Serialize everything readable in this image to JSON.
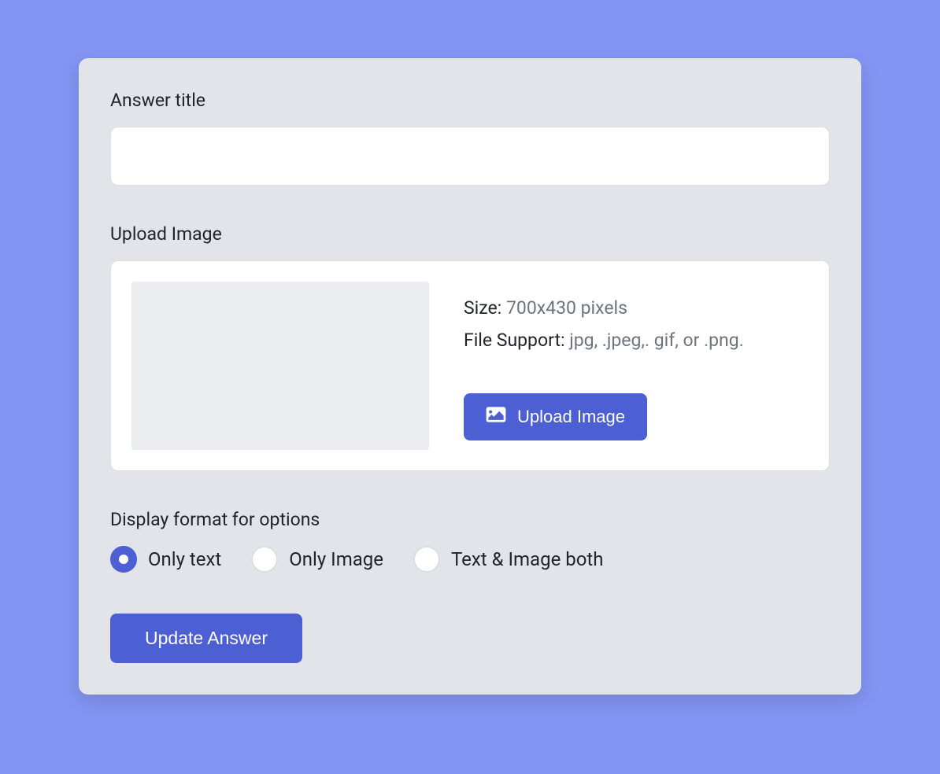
{
  "answer_title": {
    "label": "Answer title",
    "value": ""
  },
  "upload_image": {
    "label": "Upload Image",
    "size_label": "Size:",
    "size_value": "700x430 pixels",
    "file_support_label": "File Support:",
    "file_support_value": "jpg, .jpeg,. gif, or .png.",
    "button_label": "Upload Image"
  },
  "display_format": {
    "label": "Display format for options",
    "options": [
      {
        "label": "Only text",
        "selected": true
      },
      {
        "label": "Only Image",
        "selected": false
      },
      {
        "label": "Text & Image both",
        "selected": false
      }
    ]
  },
  "submit_button": "Update Answer"
}
